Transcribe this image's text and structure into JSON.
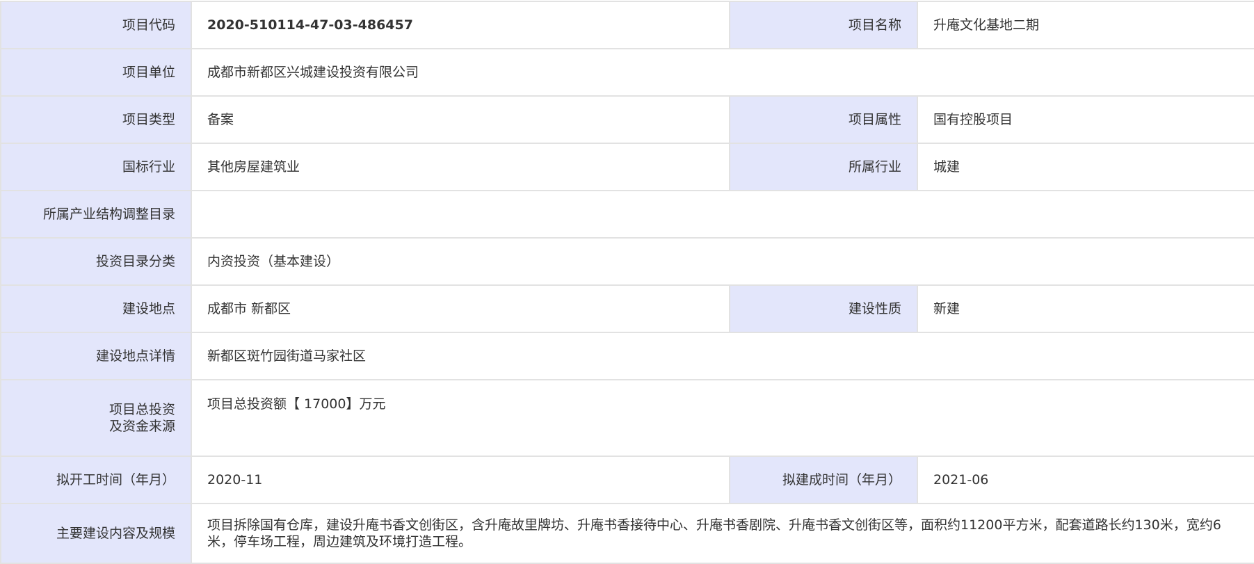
{
  "rows": [
    {
      "label": "项目代码",
      "value": "2020-510114-47-03-486457",
      "label2": "项目名称",
      "value2": "升庵文化基地二期"
    },
    {
      "label": "项目单位",
      "value": "成都市新都区兴城建设投资有限公司"
    },
    {
      "label": "项目类型",
      "value": "备案",
      "label2": "项目属性",
      "value2": "国有控股项目"
    },
    {
      "label": "国标行业",
      "value": "其他房屋建筑业",
      "label2": "所属行业",
      "value2": "城建"
    },
    {
      "label": "所属产业结构调整目录",
      "value": ""
    },
    {
      "label": "投资目录分类",
      "value": "内资投资（基本建设）"
    },
    {
      "label": "建设地点",
      "value": "成都市 新都区",
      "label2": "建设性质",
      "value2": "新建"
    },
    {
      "label": "建设地点详情",
      "value": "新都区斑竹园街道马家社区"
    },
    {
      "label_line1": "项目总投资",
      "label_line2": "及资金来源",
      "value": "项目总投资额【 17000】万元"
    },
    {
      "label": "拟开工时间（年月）",
      "value": "2020-11",
      "label2": "拟建成时间（年月）",
      "value2": "2021-06"
    },
    {
      "label": "主要建设内容及规模",
      "value": "项目拆除国有仓库，建设升庵书香文创街区，含升庵故里牌坊、升庵书香接待中心、升庵书香剧院、升庵书香文创街区等，面积约11200平方米，配套道路长约130米，宽约6米，停车场工程，周边建筑及环境打造工程。"
    }
  ]
}
